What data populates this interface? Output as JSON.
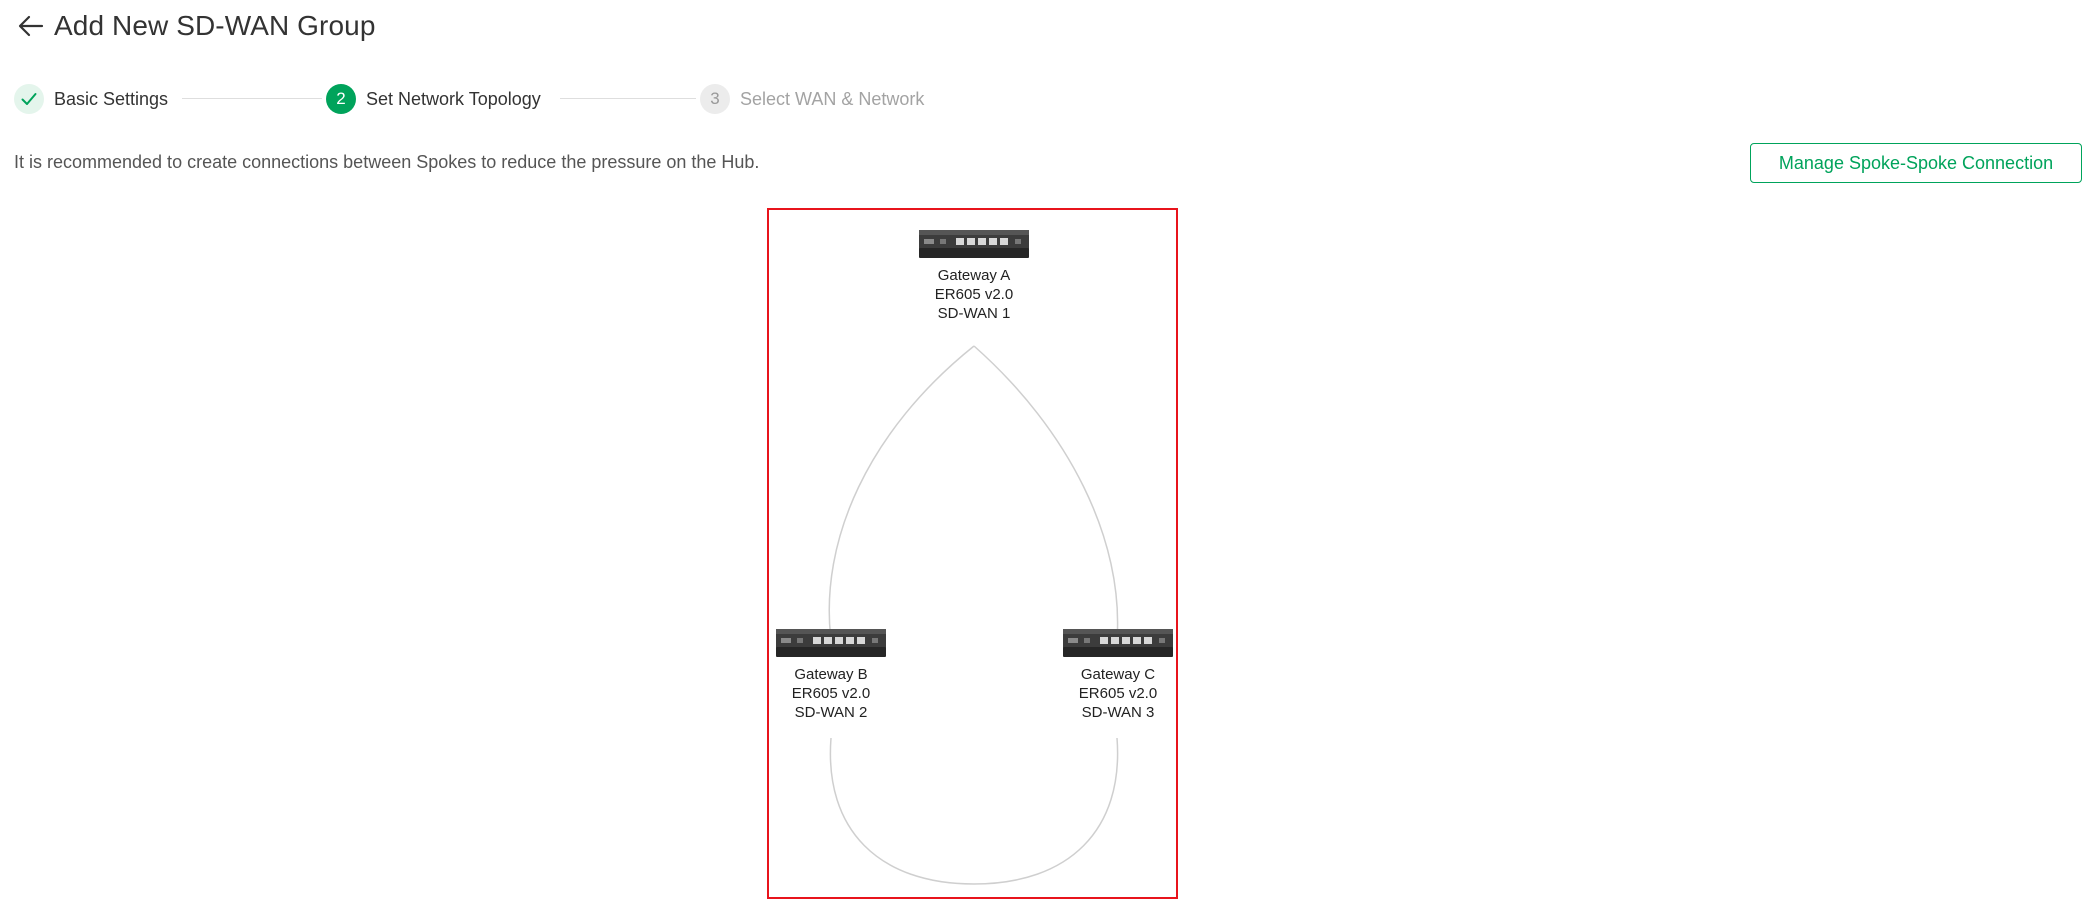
{
  "header": {
    "back_icon": "arrow-left-icon",
    "title": "Add New SD-WAN Group"
  },
  "stepper": {
    "steps": [
      {
        "marker": "",
        "label": "Basic Settings",
        "state": "done"
      },
      {
        "marker": "2",
        "label": "Set Network Topology",
        "state": "active"
      },
      {
        "marker": "3",
        "label": "Select WAN & Network",
        "state": "pending"
      }
    ]
  },
  "info_text": "It is recommended to create connections between Spokes to reduce the pressure on the Hub.",
  "manage_button_label": "Manage Spoke-Spoke Connection",
  "colors": {
    "accent": "#00a35b",
    "highlight_border": "#e8141c",
    "link_line": "#cfcfcf"
  },
  "topology": {
    "gateways": [
      {
        "name": "Gateway A",
        "model": "ER605 v2.0",
        "sdwan": "SD-WAN 1",
        "icon": "router-device-icon"
      },
      {
        "name": "Gateway B",
        "model": "ER605 v2.0",
        "sdwan": "SD-WAN 2",
        "icon": "router-device-icon"
      },
      {
        "name": "Gateway C",
        "model": "ER605 v2.0",
        "sdwan": "SD-WAN 3",
        "icon": "router-device-icon"
      }
    ]
  }
}
